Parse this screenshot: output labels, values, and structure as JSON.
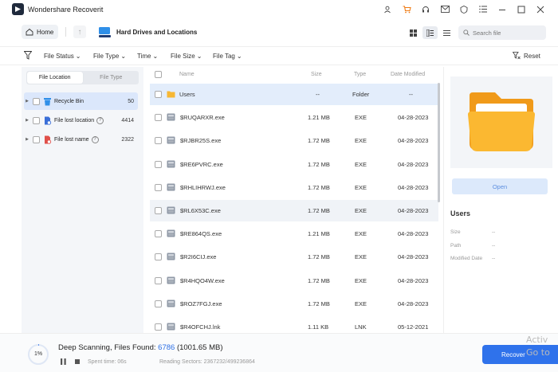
{
  "app": {
    "title": "Wondershare Recoverit"
  },
  "nav": {
    "home_label": "Home",
    "location_title": "Hard Drives and Locations",
    "search_placeholder": "Search file"
  },
  "filters": {
    "items": [
      "File Status",
      "File Type",
      "Time",
      "File Size",
      "File Tag"
    ],
    "reset_label": "Reset"
  },
  "sidebar": {
    "tabs": [
      "File Location",
      "File Type"
    ],
    "active_tab": "File Location",
    "items": [
      {
        "label": "Recycle Bin",
        "count": "50",
        "icon": "recycle-bin-icon",
        "color": "#2f8fe8"
      },
      {
        "label": "File lost location",
        "count": "4414",
        "icon": "file-lost-location-icon",
        "color": "#3a6fd8"
      },
      {
        "label": "File lost name",
        "count": "2322",
        "icon": "file-lost-name-icon",
        "color": "#e0504a"
      }
    ]
  },
  "table": {
    "headers": {
      "name": "Name",
      "size": "Size",
      "type": "Type",
      "date": "Date Modified"
    },
    "rows": [
      {
        "name": "Users",
        "size": "--",
        "type": "Folder",
        "date": "--",
        "icon": "folder-icon"
      },
      {
        "name": "$RUQARXR.exe",
        "size": "1.21 MB",
        "type": "EXE",
        "date": "04-28-2023",
        "icon": "exe-file-icon"
      },
      {
        "name": "$RJBR25S.exe",
        "size": "1.72 MB",
        "type": "EXE",
        "date": "04-28-2023",
        "icon": "exe-file-icon"
      },
      {
        "name": "$RE6PVRC.exe",
        "size": "1.72 MB",
        "type": "EXE",
        "date": "04-28-2023",
        "icon": "exe-file-icon"
      },
      {
        "name": "$RHLIHRWJ.exe",
        "size": "1.72 MB",
        "type": "EXE",
        "date": "04-28-2023",
        "icon": "exe-file-icon"
      },
      {
        "name": "$RL6X53C.exe",
        "size": "1.72 MB",
        "type": "EXE",
        "date": "04-28-2023",
        "icon": "exe-file-icon"
      },
      {
        "name": "$RE864QS.exe",
        "size": "1.21 MB",
        "type": "EXE",
        "date": "04-28-2023",
        "icon": "exe-file-icon"
      },
      {
        "name": "$R2I6CIJ.exe",
        "size": "1.72 MB",
        "type": "EXE",
        "date": "04-28-2023",
        "icon": "exe-file-icon"
      },
      {
        "name": "$R4HQO4W.exe",
        "size": "1.72 MB",
        "type": "EXE",
        "date": "04-28-2023",
        "icon": "exe-file-icon"
      },
      {
        "name": "$ROZ7FGJ.exe",
        "size": "1.72 MB",
        "type": "EXE",
        "date": "04-28-2023",
        "icon": "exe-file-icon"
      },
      {
        "name": "$R4OFCHJ.lnk",
        "size": "1.11 KB",
        "type": "LNK",
        "date": "05-12-2021",
        "icon": "lnk-file-icon"
      }
    ]
  },
  "details": {
    "title": "Users",
    "open_label": "Open",
    "size_label": "Size",
    "size_value": "--",
    "path_label": "Path",
    "path_value": "--",
    "modified_label": "Modified Date",
    "modified_value": "--"
  },
  "status": {
    "percent": "1%",
    "scan_label": "Deep Scanning, Files Found:",
    "files_found": "6786",
    "files_size": "(1001.65 MB)",
    "spent_time": "Spent time: 06s",
    "reading_sectors": "Reading Sectors: 2367232/499236864",
    "recover_label": "Recover",
    "watermark_line1": "Activ",
    "watermark_line2": "Go to"
  },
  "colors": {
    "accent": "#2f72eb",
    "selected_row": "#e3edfb",
    "folder": "#f7b733"
  }
}
